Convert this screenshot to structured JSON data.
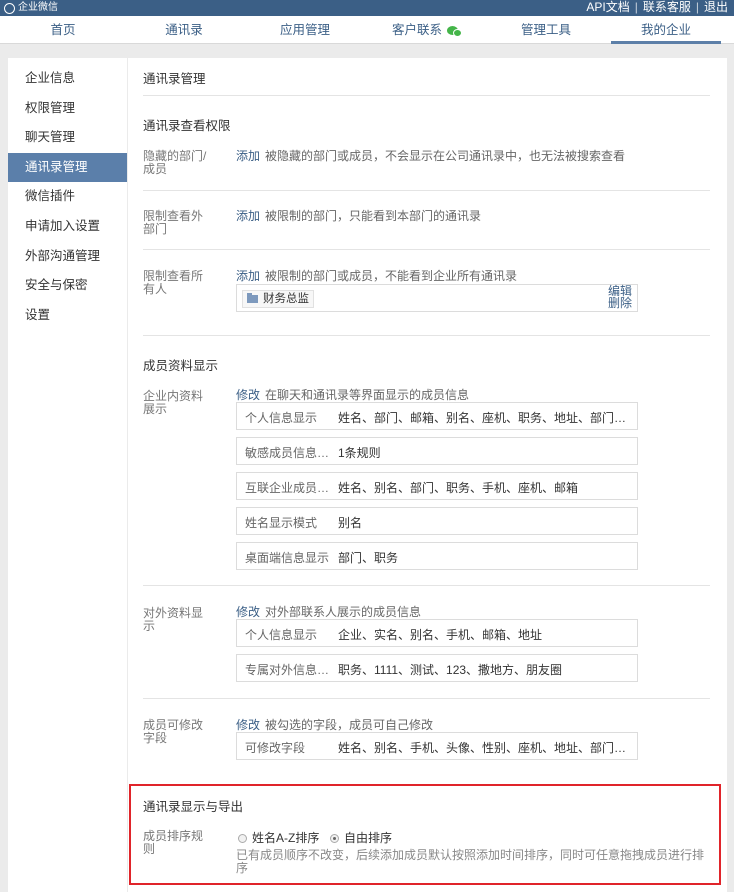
{
  "top": {
    "brand": "企业微信",
    "links": [
      "API文档",
      "联系客服",
      "退出"
    ]
  },
  "nav": {
    "items": [
      "首页",
      "通讯录",
      "应用管理",
      "客户联系",
      "管理工具",
      "我的企业"
    ],
    "active": "我的企业"
  },
  "sidebar": {
    "items": [
      "企业信息",
      "权限管理",
      "聊天管理",
      "通讯录管理",
      "微信插件",
      "申请加入设置",
      "外部沟通管理",
      "安全与保密",
      "设置"
    ],
    "active": "通讯录管理"
  },
  "main": {
    "title": "通讯录管理",
    "permission": {
      "title": "通讯录查看权限",
      "hidden": {
        "label": "隐藏的部门/成员",
        "action": "添加",
        "desc": "被隐藏的部门或成员，不会显示在公司通讯录中，也无法被搜索查看"
      },
      "limit_external": {
        "label": "限制查看外部门",
        "action": "添加",
        "desc": "被限制的部门，只能看到本部门的通讯录"
      },
      "limit_all": {
        "label": "限制查看所有人",
        "action": "添加",
        "desc": "被限制的部门或成员，不能看到企业所有通讯录",
        "tag": "财务总监",
        "edit": "编辑",
        "delete": "删除"
      }
    },
    "member_display": {
      "title": "成员资料显示",
      "internal": {
        "label": "企业内资料展示",
        "action": "修改",
        "desc": "在聊天和通讯录等界面显示的成员信息",
        "rows": [
          {
            "k": "个人信息显示",
            "v": "姓名、部门、邮箱、别名、座机、职务、地址、部门…"
          },
          {
            "k": "敏感成员信息…",
            "v": "1条规则"
          },
          {
            "k": "互联企业成员…",
            "v": "姓名、别名、部门、职务、手机、座机、邮箱"
          },
          {
            "k": "姓名显示模式",
            "v": "别名"
          },
          {
            "k": "桌面端信息显示",
            "v": "部门、职务"
          }
        ]
      },
      "external": {
        "label": "对外资料显示",
        "action": "修改",
        "desc": "对外部联系人展示的成员信息",
        "rows": [
          {
            "k": "个人信息显示",
            "v": "企业、实名、别名、手机、邮箱、地址"
          },
          {
            "k": "专属对外信息…",
            "v": "职务、1111、测试、123、撒地方、朋友圈"
          }
        ]
      },
      "editable": {
        "label": "成员可修改字段",
        "action": "修改",
        "desc": "被勾选的字段，成员可自己修改",
        "rows": [
          {
            "k": "可修改字段",
            "v": "姓名、别名、手机、头像、性别、座机、地址、部门…"
          }
        ]
      }
    },
    "export": {
      "title": "通讯录显示与导出",
      "sort_label": "成员排序规则",
      "options": [
        "姓名A-Z排序",
        "自由排序"
      ],
      "selected": "自由排序",
      "note": "已有成员顺序不改变，后续添加成员默认按照添加时间排序，同时可任意拖拽成员进行排序"
    }
  },
  "colors": {
    "topbar": "#3b5f86",
    "active_side": "#5b7faa",
    "highlight": "#e0242a",
    "wechat": "#44b549"
  }
}
